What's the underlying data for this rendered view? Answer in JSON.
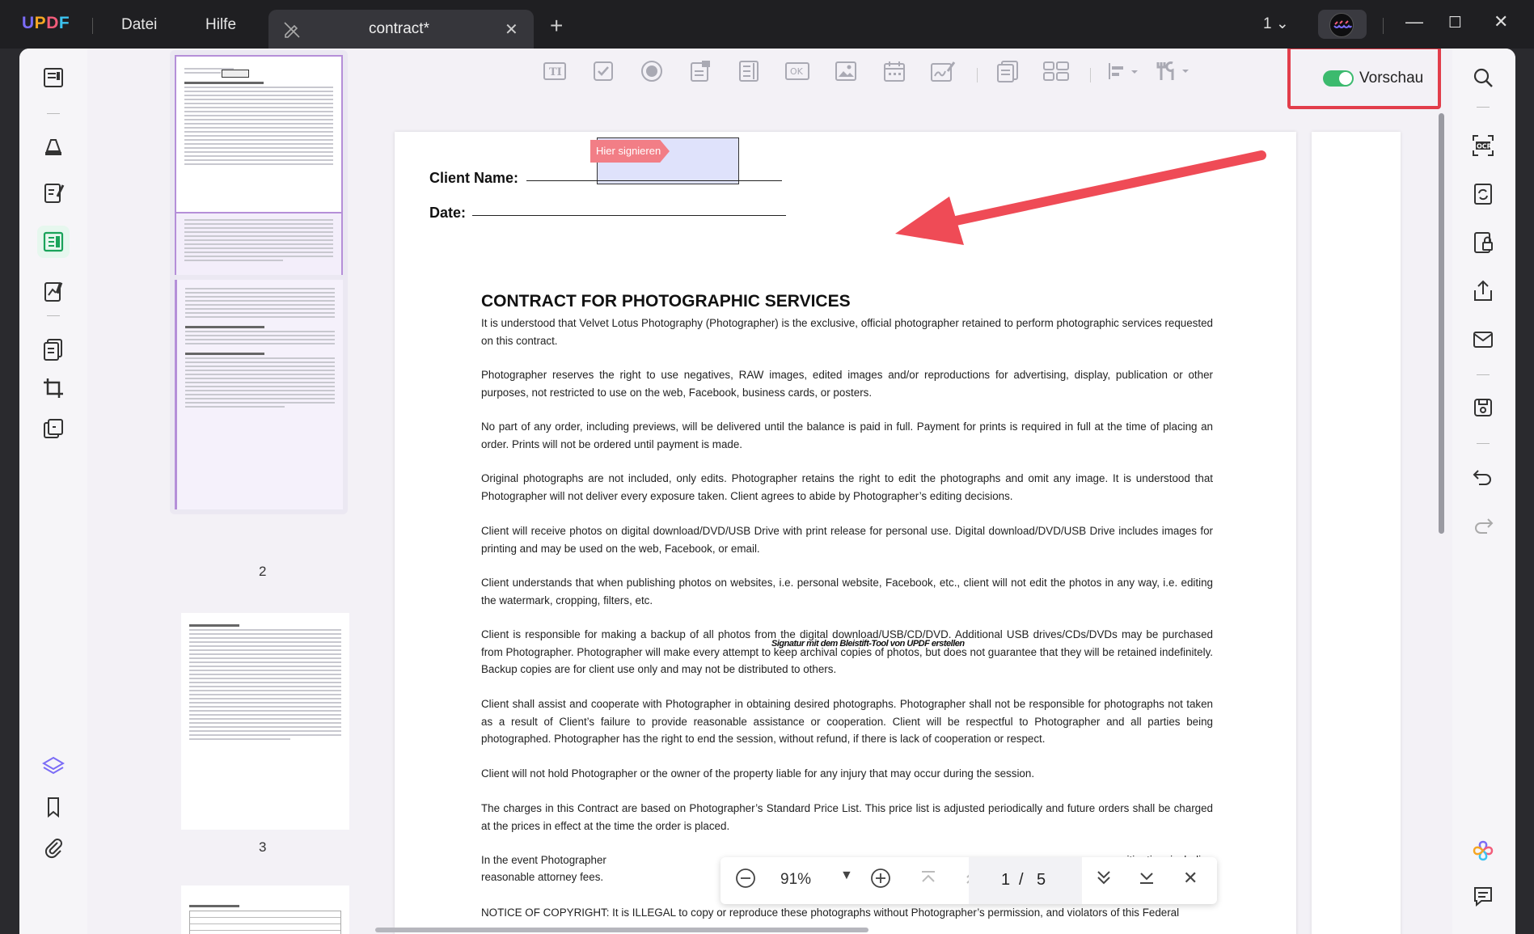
{
  "app": {
    "logo": "UPDF",
    "menu": [
      "Datei",
      "Hilfe"
    ],
    "tab_title": "contract*",
    "page_selector": "1",
    "colors": {
      "accent": "#7b6cf6",
      "toggle_on": "#3cba6e",
      "highlight_box": "#e23d4b",
      "sign_tag": "#f27e86"
    }
  },
  "toolbar": {
    "tools": [
      "text-field-icon",
      "checkbox-icon",
      "radio-icon",
      "dropdown-icon",
      "list-box-icon",
      "button-icon",
      "image-field-icon",
      "date-field-icon",
      "signature-field-icon",
      "multi-page-icon",
      "grid-icon",
      "align-icon",
      "tools-icon"
    ],
    "preview_label": "Vorschau",
    "preview_enabled": true
  },
  "thumbnails": [
    {
      "page": "1"
    },
    {
      "page": "2"
    },
    {
      "page": "3"
    }
  ],
  "document": {
    "sign_tag": "Hier signieren",
    "client_name_label": "Client Name:",
    "date_label": "Date:",
    "title": "CONTRACT FOR PHOTOGRAPHIC SERVICES",
    "paragraphs": [
      "It is understood that Velvet Lotus Photography (Photographer) is the exclusive, official photographer retained to perform photographic services requested on this contract.",
      "Photographer reserves the right to use negatives, RAW images, edited images and/or reproductions for advertising, display, publication or other purposes, not restricted to use on the web, Facebook, business cards, or posters.",
      "No part of any order, including previews, will be delivered until the balance is paid in full. Payment for prints is required in full at the time of placing an order. Prints will not be ordered until payment is made.",
      "Original photographs are not included, only edits. Photographer retains the right to edit the photographs and omit any image. It is understood that Photographer will not deliver every exposure taken. Client agrees to abide by Photographer’s editing decisions.",
      "Client will receive photos on digital download/DVD/USB Drive with print release for personal use. Digital download/DVD/USB Drive includes images for printing and may be used on the web, Facebook, or email.",
      "Client understands that when publishing photos on websites, i.e. personal website, Facebook, etc., client will not edit the photos in any way, i.e. editing the watermark, cropping, filters, etc.",
      "Client is responsible for making a backup of all photos from the digital download/USB/CD/DVD. Additional USB drives/CDs/DVDs may be purchased from Photographer. Photographer will make every attempt to keep archival copies of photos, but does not guarantee that they will be retained indefinitely. Backup copies are for client use only and may not be distributed to others.",
      "Client shall assist and cooperate with Photographer in obtaining desired photographs. Photographer shall not be responsible for photographs not taken as a result of Client’s failure to provide reasonable assistance or cooperation. Client will be respectful to Photographer and all parties being photographed. Photographer has the right to end the session, without refund, if there is lack of cooperation or respect.",
      "Client will not hold Photographer or the owner of the property liable for any injury that may occur during the session.",
      "The charges in this Contract are based on Photographer’s Standard Price List. This price list is adjusted periodically and future orders shall be charged at the prices in effect at the time the order is placed.",
      "In the event Photographer",
      "reasonable attorney fees.",
      "NOTICE OF COPYRIGHT: It is ILLEGAL to copy or reproduce these photographs without Photographer’s permission, and violators of this Federal"
    ],
    "para8_tail": "itigation, including",
    "signature_overlay": "Signatur mit dem Bleistift-Tool von UPDF erstellen"
  },
  "navbar": {
    "zoom": "91%",
    "page_current": "1",
    "page_sep": "/",
    "page_total": "5"
  }
}
